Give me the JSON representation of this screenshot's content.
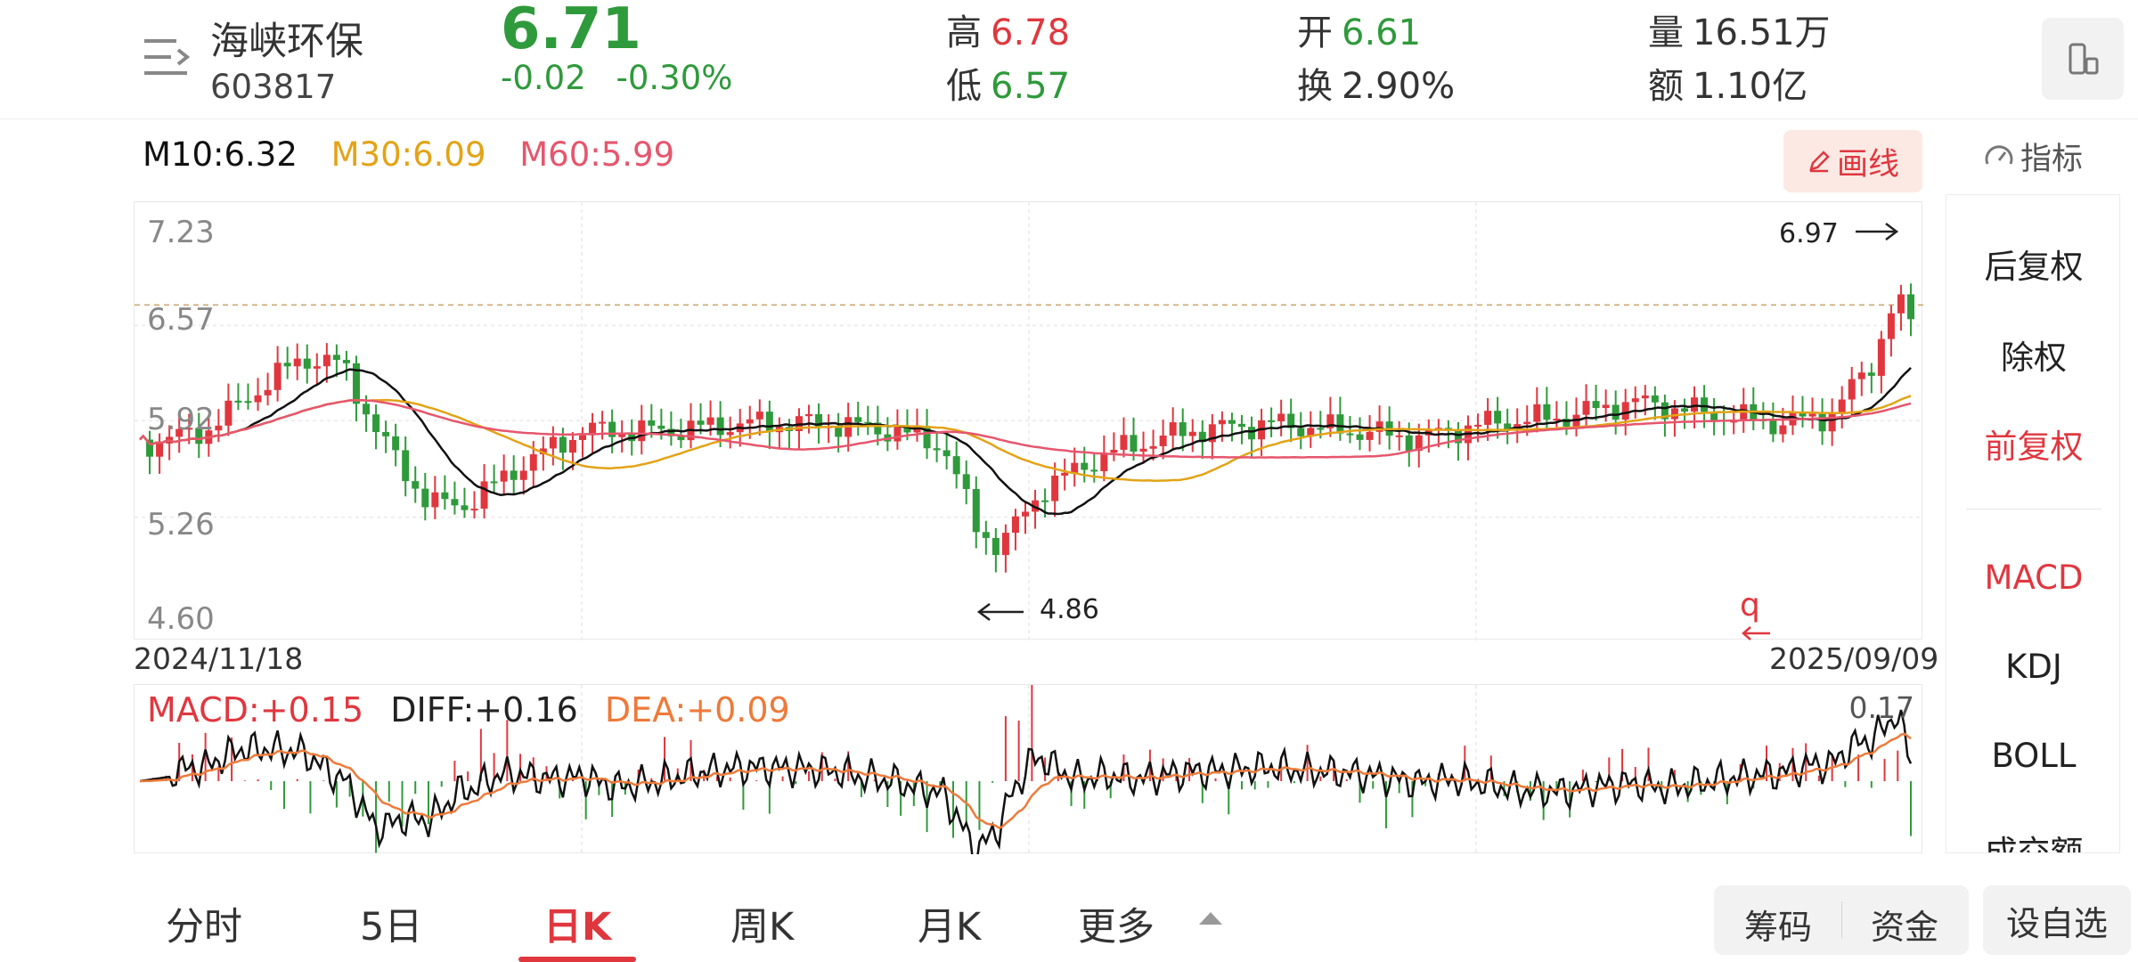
{
  "header": {
    "name": "海峡环保",
    "code": "603817",
    "price": "6.71",
    "change": "-0.02",
    "change_pct": "-0.30%",
    "high_label": "高",
    "high": "6.78",
    "low_label": "低",
    "low": "6.57",
    "open_label": "开",
    "open": "6.61",
    "turnover_label": "换",
    "turnover": "2.90%",
    "volume_label": "量",
    "volume": "16.51万",
    "amount_label": "额",
    "amount": "1.10亿"
  },
  "ma": {
    "m10": "M10:6.32",
    "m30": "M30:6.09",
    "m60": "M60:5.99",
    "colors": {
      "m10": "#111111",
      "m30": "#e3a317",
      "m60": "#e6566d"
    }
  },
  "toolbar": {
    "draw_label": "画线",
    "indicator_label": "指标"
  },
  "chart_data": {
    "type": "candlestick",
    "y_ticks": [
      "7.23",
      "6.57",
      "5.92",
      "5.26",
      "4.60"
    ],
    "ylim": [
      4.6,
      7.23
    ],
    "start_date": "2024/11/18",
    "end_date": "2025/09/09",
    "max_label": "6.97",
    "min_label": "4.86",
    "note_mark": "q",
    "colors": {
      "up": "#e0373f",
      "down": "#2f9a3b"
    }
  },
  "macd": {
    "macd_label": "MACD:+0.15",
    "diff_label": "DIFF:+0.16",
    "dea_label": "DEA:+0.09",
    "max_label": "0.17"
  },
  "right_panel": {
    "items": [
      "后复权",
      "除权",
      "前复权",
      "MACD",
      "KDJ",
      "BOLL",
      "成交额"
    ]
  },
  "tabs": {
    "items": [
      "分时",
      "5日",
      "日K",
      "周K",
      "月K",
      "更多"
    ]
  },
  "buttons": {
    "chips": "筹码",
    "funds": "资金",
    "add_fav": "设自选"
  }
}
